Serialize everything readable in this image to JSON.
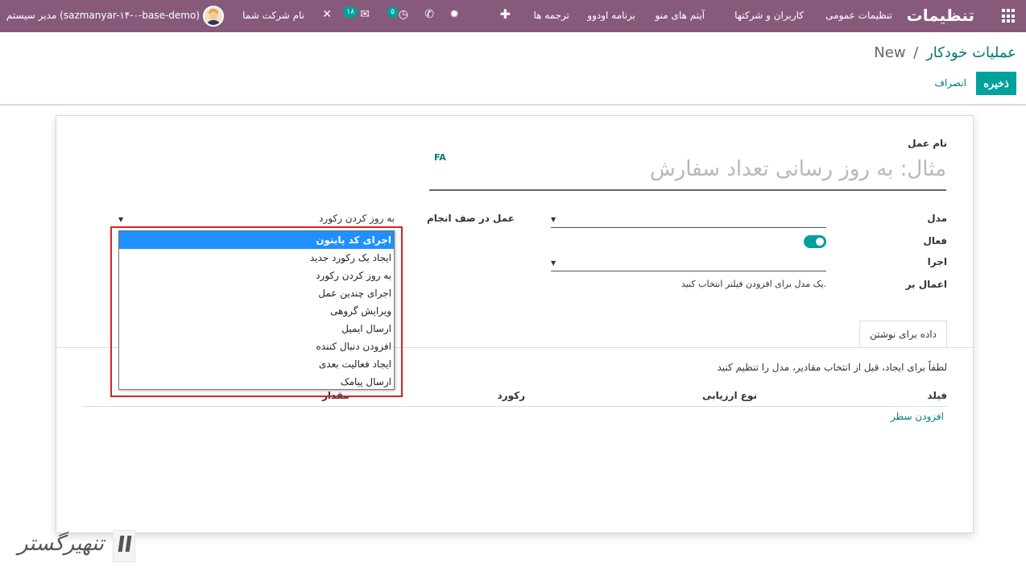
{
  "navbar": {
    "brand": "تنظیمات",
    "menu": [
      "تنظیمات عمومی",
      "کاربران و شرکتها",
      "آیتم های منو",
      "برنامه اودوو",
      "ترجمه ها"
    ],
    "activity_badge": "۵",
    "messages_badge": "۱۸",
    "company": "نام شرکت شما",
    "user": "مدیر سیستم (sazmanyar-۱۴-۰-base-demo)",
    "icons": [
      "apps-icon",
      "plus-icon",
      "bug-icon",
      "phone-icon",
      "clock-icon",
      "chat-icon",
      "tools-icon"
    ]
  },
  "breadcrumb": {
    "parent": "عملیات خودکار",
    "separator": "/",
    "current": "New"
  },
  "buttons": {
    "save": "ذخیره",
    "discard": "انصراف"
  },
  "form": {
    "name_label": "نام عمل",
    "name_placeholder": "مثال: به روز رسانی تعداد سفارش",
    "lang": "FA",
    "model_label": "مدل",
    "active_label": "فعال",
    "active": true,
    "trigger_label": "اجرا",
    "apply_on_label": "اعمال بر",
    "apply_on_help": "یک مدل برای افزودن فیلتر انتخاب کنید.",
    "action_label": "عمل در صف انجام",
    "action_value": "به روز کردن رکورد"
  },
  "dropdown": {
    "options": [
      "اجرای کد پایتون",
      "ایجاد یک رکورد جدید",
      "به روز کردن رکورد",
      "اجرای چندین عمل",
      "ویرایش گروهی",
      "ارسال ایمیل",
      "افزودن دنبال کننده",
      "ایجاد فعالیت بعدی",
      "ارسال پیامک"
    ],
    "selected_index": 0
  },
  "tab": {
    "label": "داده برای نوشتن",
    "hint": "لطفاً برای ایجاد، قبل از انتخاب مقادیر، مدل را تنظیم کنید",
    "columns": [
      "فیلد",
      "نوع ارزیابی",
      "رکورد",
      "مقدار"
    ],
    "add_line": "افزودن سطر"
  },
  "watermark": {
    "text": "تنهیرگستر"
  },
  "colors": {
    "navbar": "#875a7b",
    "primary": "#00a09d",
    "link": "#00787b",
    "highlight": "#e02020",
    "selected": "#1e90ff"
  }
}
